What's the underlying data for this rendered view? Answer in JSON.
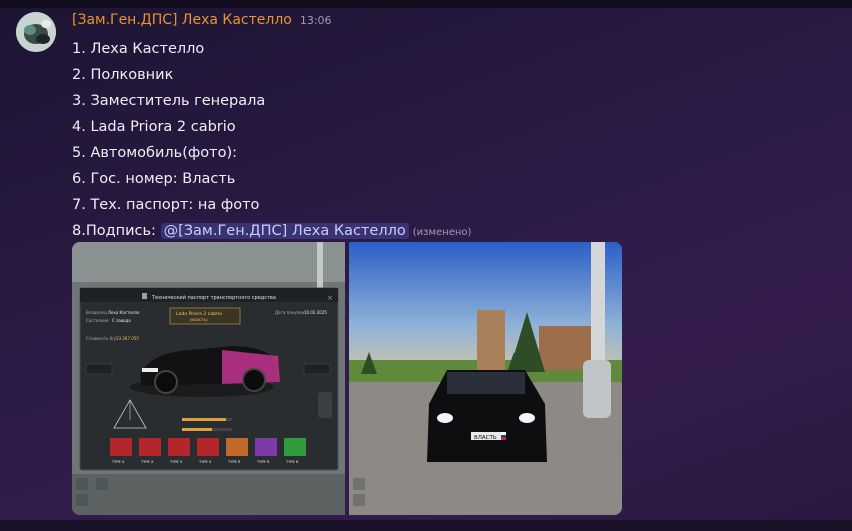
{
  "message": {
    "username": "[Зам.Ген.ДПС] Леха Кастелло",
    "timestamp": "13:06",
    "lines": [
      "1. Леха Кастелло",
      "2. Полковник",
      "3. Заместитель генерала",
      "4. Lada Priora 2 cabrio",
      "5. Автомобиль(фото):",
      "6. Гос. номер: Власть",
      "7. Тех. паспорт: на фото"
    ],
    "signature_label": "8.Подпись: ",
    "signature_mention": "@[Зам.Ген.ДПС] Леха Кастелло",
    "edited_label": "(изменено)"
  },
  "attachments": {
    "passport": {
      "title": "Технический паспорт транспортного средства",
      "owner_label": "Владелец:",
      "owner": "Леха Кастелло",
      "car_name": "Lada Priora 2 cabrio",
      "car_sub": "(ВЛАСТЬ)",
      "purchase_label": "Дата покупки:",
      "purchase_date": "10.02.2025",
      "condition_label": "Состояние:",
      "condition": "С завода",
      "cost_label": "Стоимость б/у:",
      "cost": "13 267 055",
      "type_labels": [
        "TYPE X",
        "TYPE X",
        "TYPE X",
        "TYPE X",
        "TYPE R",
        "TYPE R",
        "TYPE R"
      ],
      "type_colors": [
        "#b3262c",
        "#b3262c",
        "#b3262c",
        "#b3262c",
        "#c0692a",
        "#7d3aa8",
        "#2f9b3c"
      ]
    },
    "car_photo": {
      "plate": "ВЛАСТЬ"
    }
  }
}
